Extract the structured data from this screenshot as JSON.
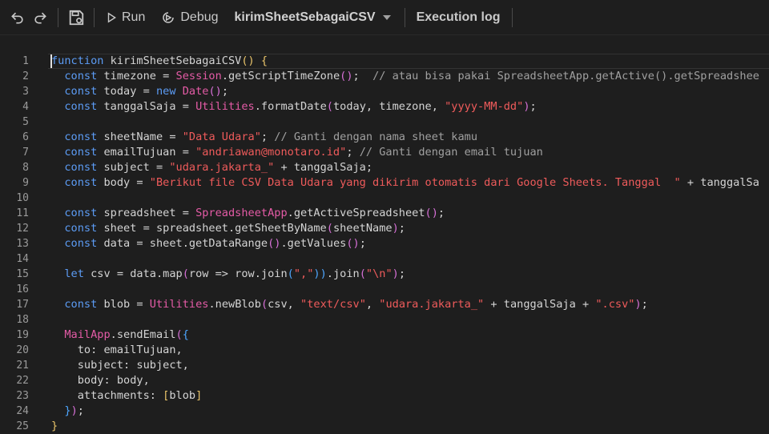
{
  "toolbar": {
    "undo_icon": "undo-icon",
    "redo_icon": "redo-icon",
    "save_icon": "save-icon",
    "run_label": "Run",
    "debug_label": "Debug",
    "function_name": "kirimSheetSebagaiCSV",
    "execution_log_label": "Execution log"
  },
  "editor": {
    "line_numbers": [
      "1",
      "2",
      "3",
      "4",
      "5",
      "6",
      "7",
      "8",
      "9",
      "10",
      "11",
      "12",
      "13",
      "14",
      "15",
      "16",
      "17",
      "18",
      "19",
      "20",
      "21",
      "22",
      "23",
      "24",
      "25"
    ],
    "lines": [
      [
        [
          "kw",
          "function"
        ],
        [
          "id",
          " kirimSheetSebagaiCSV"
        ],
        [
          "br1",
          "()"
        ],
        [
          "id",
          " "
        ],
        [
          "br1",
          "{"
        ]
      ],
      [
        [
          "id",
          "  "
        ],
        [
          "kw",
          "const"
        ],
        [
          "id",
          " timezone = "
        ],
        [
          "cls",
          "Session"
        ],
        [
          "id",
          ".getScriptTimeZone"
        ],
        [
          "br2",
          "()"
        ],
        [
          "id",
          ";  "
        ],
        [
          "cmt",
          "// atau bisa pakai SpreadsheetApp.getActive().getSpreadshee"
        ]
      ],
      [
        [
          "id",
          "  "
        ],
        [
          "kw",
          "const"
        ],
        [
          "id",
          " today = "
        ],
        [
          "kw",
          "new"
        ],
        [
          "id",
          " "
        ],
        [
          "cls",
          "Date"
        ],
        [
          "br2",
          "()"
        ],
        [
          "id",
          ";"
        ]
      ],
      [
        [
          "id",
          "  "
        ],
        [
          "kw",
          "const"
        ],
        [
          "id",
          " tanggalSaja = "
        ],
        [
          "cls",
          "Utilities"
        ],
        [
          "id",
          ".formatDate"
        ],
        [
          "br2",
          "("
        ],
        [
          "id",
          "today, timezone, "
        ],
        [
          "str",
          "\"yyyy-MM-dd\""
        ],
        [
          "br2",
          ")"
        ],
        [
          "id",
          ";"
        ]
      ],
      [],
      [
        [
          "id",
          "  "
        ],
        [
          "kw",
          "const"
        ],
        [
          "id",
          " sheetName = "
        ],
        [
          "str",
          "\"Data Udara\""
        ],
        [
          "id",
          "; "
        ],
        [
          "cmt",
          "// Ganti dengan nama sheet kamu"
        ]
      ],
      [
        [
          "id",
          "  "
        ],
        [
          "kw",
          "const"
        ],
        [
          "id",
          " emailTujuan = "
        ],
        [
          "str",
          "\"andriawan@monotaro.id\""
        ],
        [
          "id",
          "; "
        ],
        [
          "cmt",
          "// Ganti dengan email tujuan"
        ]
      ],
      [
        [
          "id",
          "  "
        ],
        [
          "kw",
          "const"
        ],
        [
          "id",
          " subject = "
        ],
        [
          "str",
          "\"udara.jakarta_\""
        ],
        [
          "id",
          " + tanggalSaja;"
        ]
      ],
      [
        [
          "id",
          "  "
        ],
        [
          "kw",
          "const"
        ],
        [
          "id",
          " body = "
        ],
        [
          "str",
          "\"Berikut file CSV Data Udara yang dikirim otomatis dari Google Sheets. Tanggal  \""
        ],
        [
          "id",
          " + tanggalSa"
        ]
      ],
      [],
      [
        [
          "id",
          "  "
        ],
        [
          "kw",
          "const"
        ],
        [
          "id",
          " spreadsheet = "
        ],
        [
          "cls",
          "SpreadsheetApp"
        ],
        [
          "id",
          ".getActiveSpreadsheet"
        ],
        [
          "br2",
          "()"
        ],
        [
          "id",
          ";"
        ]
      ],
      [
        [
          "id",
          "  "
        ],
        [
          "kw",
          "const"
        ],
        [
          "id",
          " sheet = spreadsheet.getSheetByName"
        ],
        [
          "br2",
          "("
        ],
        [
          "id",
          "sheetName"
        ],
        [
          "br2",
          ")"
        ],
        [
          "id",
          ";"
        ]
      ],
      [
        [
          "id",
          "  "
        ],
        [
          "kw",
          "const"
        ],
        [
          "id",
          " data = sheet.getDataRange"
        ],
        [
          "br2",
          "()"
        ],
        [
          "id",
          ".getValues"
        ],
        [
          "br2",
          "()"
        ],
        [
          "id",
          ";"
        ]
      ],
      [],
      [
        [
          "id",
          "  "
        ],
        [
          "kw",
          "let"
        ],
        [
          "id",
          " csv = data.map"
        ],
        [
          "br2",
          "("
        ],
        [
          "id",
          "row => row.join"
        ],
        [
          "br3",
          "("
        ],
        [
          "str",
          "\",\""
        ],
        [
          "br3",
          "))"
        ],
        [
          "id",
          ".join"
        ],
        [
          "br2",
          "("
        ],
        [
          "str",
          "\"\\n\""
        ],
        [
          "br2",
          ")"
        ],
        [
          "id",
          ";"
        ]
      ],
      [],
      [
        [
          "id",
          "  "
        ],
        [
          "kw",
          "const"
        ],
        [
          "id",
          " blob = "
        ],
        [
          "cls",
          "Utilities"
        ],
        [
          "id",
          ".newBlob"
        ],
        [
          "br2",
          "("
        ],
        [
          "id",
          "csv, "
        ],
        [
          "str",
          "\"text/csv\""
        ],
        [
          "id",
          ", "
        ],
        [
          "str",
          "\"udara.jakarta_\""
        ],
        [
          "id",
          " + tanggalSaja + "
        ],
        [
          "str",
          "\".csv\""
        ],
        [
          "br2",
          ")"
        ],
        [
          "id",
          ";"
        ]
      ],
      [],
      [
        [
          "id",
          "  "
        ],
        [
          "cls",
          "MailApp"
        ],
        [
          "id",
          ".sendEmail"
        ],
        [
          "br2",
          "("
        ],
        [
          "br3",
          "{"
        ]
      ],
      [
        [
          "id",
          "    to: emailTujuan,"
        ]
      ],
      [
        [
          "id",
          "    subject: subject,"
        ]
      ],
      [
        [
          "id",
          "    body: body,"
        ]
      ],
      [
        [
          "id",
          "    attachments: "
        ],
        [
          "br1",
          "["
        ],
        [
          "id",
          "blob"
        ],
        [
          "br1",
          "]"
        ]
      ],
      [
        [
          "id",
          "  "
        ],
        [
          "br3",
          "}"
        ],
        [
          "br2",
          ")"
        ],
        [
          "id",
          ";"
        ]
      ],
      [
        [
          "br1",
          "}"
        ]
      ]
    ]
  }
}
